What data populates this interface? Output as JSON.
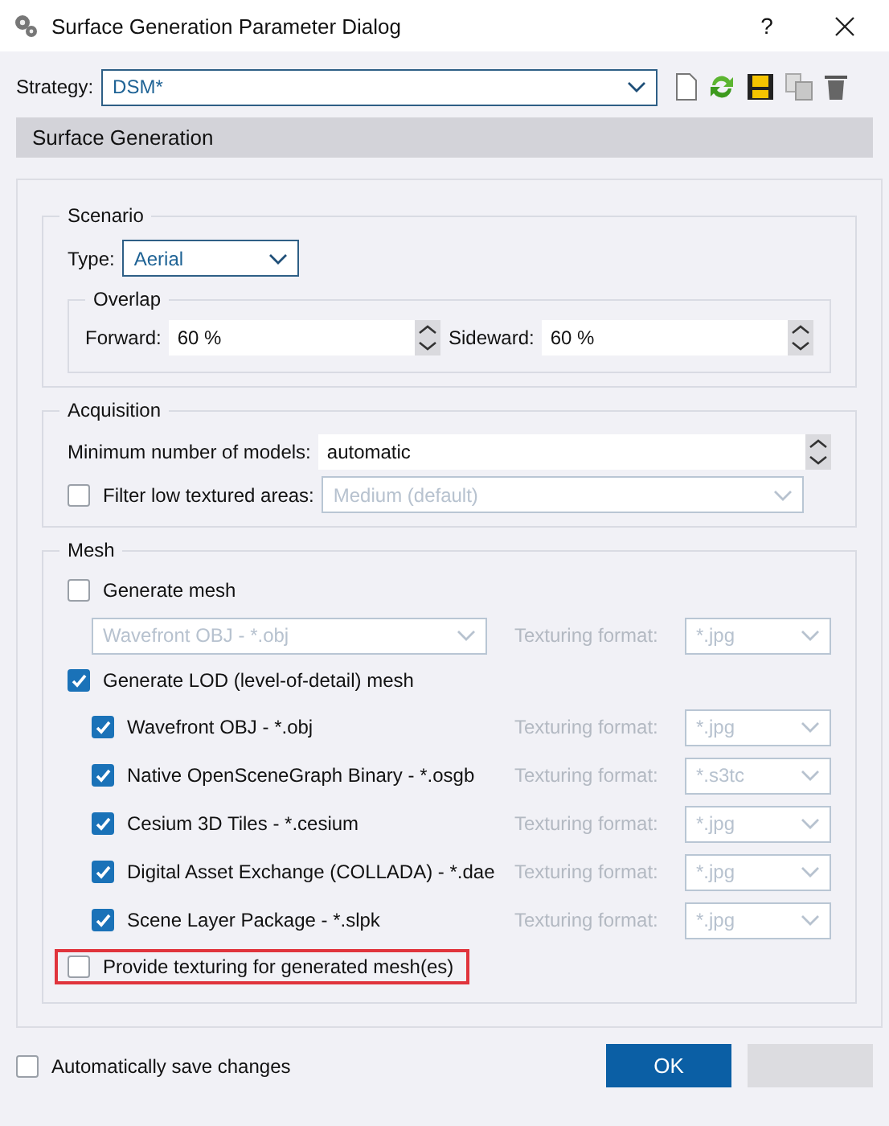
{
  "window": {
    "title": "Surface Generation Parameter Dialog",
    "help": "?"
  },
  "strategy": {
    "label": "Strategy:",
    "value": "DSM*"
  },
  "section_header": "Surface Generation",
  "scenario": {
    "title": "Scenario",
    "type_label": "Type:",
    "type_value": "Aerial",
    "overlap": {
      "title": "Overlap",
      "fields": [
        {
          "label": "Forward:",
          "value": "60 %"
        },
        {
          "label": "Sideward:",
          "value": "60 %"
        }
      ]
    }
  },
  "acquisition": {
    "title": "Acquisition",
    "min_models": {
      "label": "Minimum number of models:",
      "value": "automatic"
    },
    "filter": {
      "label": "Filter low textured areas:",
      "checked": false,
      "value": "Medium (default)",
      "disabled": true
    }
  },
  "mesh": {
    "title": "Mesh",
    "items": [
      {
        "kind": "option",
        "label": "Generate mesh",
        "checked": false,
        "highlighted": false
      },
      {
        "kind": "format",
        "format": "Wavefront OBJ - *.obj",
        "texturing_label": "Texturing format:",
        "texturing": "*.jpg",
        "disabled": true
      },
      {
        "kind": "option",
        "label": "Generate LOD (level-of-detail) mesh",
        "checked": true,
        "highlighted": false
      },
      {
        "kind": "lod",
        "label": "Wavefront OBJ - *.obj",
        "checked": true,
        "texturing_label": "Texturing format:",
        "texturing": "*.jpg",
        "disabled": true
      },
      {
        "kind": "lod",
        "label": "Native OpenSceneGraph Binary - *.osgb",
        "checked": true,
        "texturing_label": "Texturing format:",
        "texturing": "*.s3tc",
        "disabled": true
      },
      {
        "kind": "lod",
        "label": "Cesium 3D Tiles - *.cesium",
        "checked": true,
        "texturing_label": "Texturing format:",
        "texturing": "*.jpg",
        "disabled": true
      },
      {
        "kind": "lod",
        "label": "Digital Asset Exchange (COLLADA) - *.dae",
        "checked": true,
        "texturing_label": "Texturing format:",
        "texturing": "*.jpg",
        "disabled": true
      },
      {
        "kind": "lod",
        "label": "Scene Layer Package - *.slpk",
        "checked": true,
        "texturing_label": "Texturing format:",
        "texturing": "*.jpg",
        "disabled": true
      },
      {
        "kind": "option",
        "label": "Provide texturing for generated mesh(es)",
        "checked": false,
        "highlighted": true
      }
    ]
  },
  "footer": {
    "auto_save": {
      "label": "Automatically save changes",
      "checked": false
    },
    "ok": "OK"
  }
}
